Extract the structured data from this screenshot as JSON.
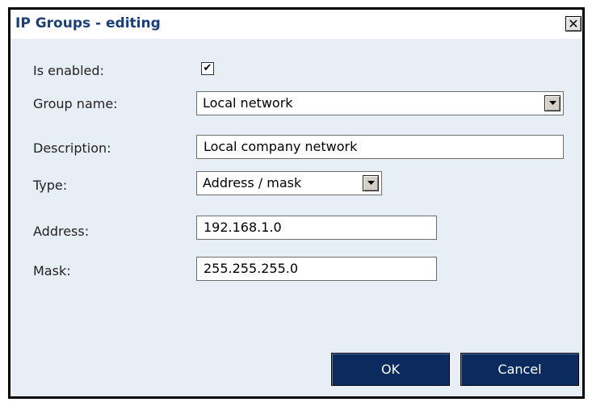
{
  "dialog": {
    "title": "IP Groups - editing",
    "close_glyph": "✕"
  },
  "form": {
    "is_enabled": {
      "label": "Is enabled:",
      "checked": true,
      "check_glyph": "✔"
    },
    "group_name": {
      "label": "Group name:",
      "value": "Local network"
    },
    "description": {
      "label": "Description:",
      "value": "Local company network"
    },
    "type": {
      "label": "Type:",
      "value": "Address / mask"
    },
    "address": {
      "label": "Address:",
      "value": "192.168.1.0"
    },
    "mask": {
      "label": "Mask:",
      "value": "255.255.255.0"
    }
  },
  "buttons": {
    "ok": "OK",
    "cancel": "Cancel"
  },
  "colors": {
    "title": "#1b3f78",
    "dialog_bg": "#e8eef6",
    "button_bg": "#0b2a5e"
  }
}
